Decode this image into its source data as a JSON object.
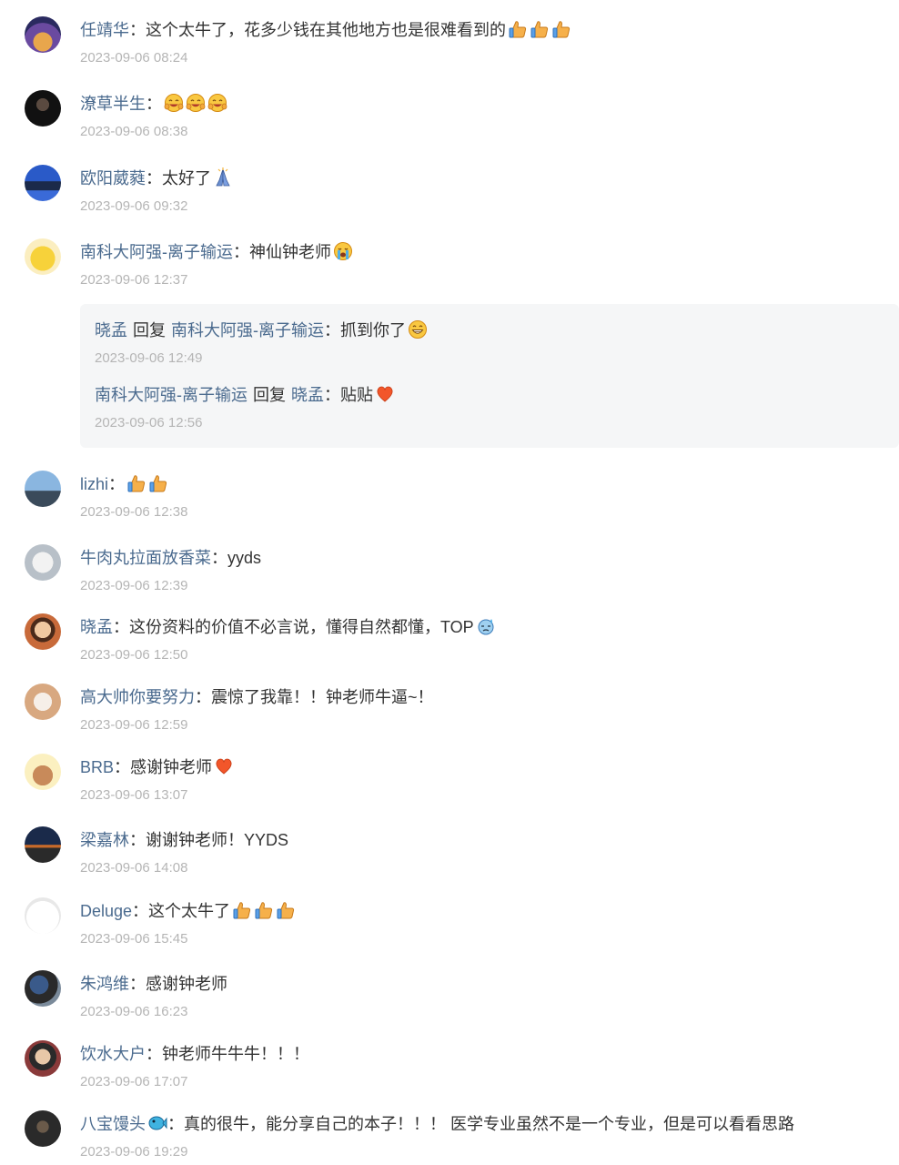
{
  "comments": [
    {
      "author": "任靖华",
      "text": "这个太牛了，花多少钱在其他地方也是很难看到的",
      "emojis": [
        "thumbs-up",
        "thumbs-up",
        "thumbs-up"
      ],
      "time": "2023-09-06 08:24",
      "avatar": "castle-night-avatar"
    },
    {
      "author": "潦草半生",
      "text": "",
      "emojis": [
        "laughing-face",
        "laughing-face",
        "laughing-face"
      ],
      "time": "2023-09-06 08:38",
      "avatar": "dark-portrait-avatar"
    },
    {
      "author": "欧阳葳蕤",
      "text": "太好了",
      "emojis": [
        "praying-hands"
      ],
      "time": "2023-09-06 09:32",
      "avatar": "pagoda-blue-avatar"
    },
    {
      "author": "南科大阿强-离子输运",
      "text": "神仙钟老师",
      "emojis": [
        "crying-face"
      ],
      "time": "2023-09-06 12:37",
      "avatar": "pikachu-avatar"
    },
    {
      "author": "lizhi",
      "text": "",
      "emojis": [
        "thumbs-up",
        "thumbs-up"
      ],
      "time": "2023-09-06 12:38",
      "avatar": "mountain-person-avatar"
    },
    {
      "author": "牛肉丸拉面放香菜",
      "text": "yyds",
      "emojis": [],
      "time": "2023-09-06 12:39",
      "avatar": "cat-avatar"
    },
    {
      "author": "晓孟",
      "text": "这份资料的价值不必言说，懂得自然都懂，TOP",
      "emojis": [
        "sweat-face"
      ],
      "time": "2023-09-06 12:50",
      "avatar": "child-photo-avatar"
    },
    {
      "author": "高大帅你要努力",
      "text": "震惊了我靠！！钟老师牛逼~！",
      "emojis": [],
      "time": "2023-09-06 12:59",
      "avatar": "fox-avatar"
    },
    {
      "author": "BRB",
      "text": "感谢钟老师",
      "emojis": [
        "heart"
      ],
      "time": "2023-09-06 13:07",
      "avatar": "bear-avatar"
    },
    {
      "author": "梁嘉林",
      "text": "谢谢钟老师！YYDS",
      "emojis": [],
      "time": "2023-09-06 14:08",
      "avatar": "city-night-avatar"
    },
    {
      "author": "Deluge",
      "text": "这个太牛了",
      "emojis": [
        "thumbs-up",
        "thumbs-up",
        "thumbs-up"
      ],
      "time": "2023-09-06 15:45",
      "avatar": "sketch-figure-avatar"
    },
    {
      "author": "朱鸿维",
      "text": "感谢钟老师",
      "emojis": [],
      "time": "2023-09-06 16:23",
      "avatar": "group-photo-avatar"
    },
    {
      "author": "饮水大户",
      "text": "钟老师牛牛牛！！！",
      "emojis": [],
      "time": "2023-09-06 17:07",
      "avatar": "kid-photo-avatar"
    },
    {
      "author": "八宝馒头",
      "text": "真的很牛，能分享自己的本子！！！ 医学专业虽然不是一个专业，但是可以看看思路",
      "emojis": [],
      "author_emoji": "fish",
      "time": "2023-09-06 19:29",
      "avatar": "hooded-figure-avatar"
    }
  ],
  "replies": [
    {
      "from": "晓孟",
      "reply_word": "回复",
      "to": "南科大阿强-离子输运",
      "text": "抓到你了",
      "emojis": [
        "grinning-face"
      ],
      "time": "2023-09-06 12:49"
    },
    {
      "from": "南科大阿强-离子输运",
      "reply_word": "回复",
      "to": "晓孟",
      "text": "贴贴",
      "emojis": [
        "heart"
      ],
      "time": "2023-09-06 12:56"
    }
  ],
  "punctuation": {
    "colon": "："
  },
  "colors": {
    "author": "#4a6a8e",
    "text": "#333333",
    "time": "#b5b5b5",
    "reply_bg": "#f5f6f7"
  }
}
